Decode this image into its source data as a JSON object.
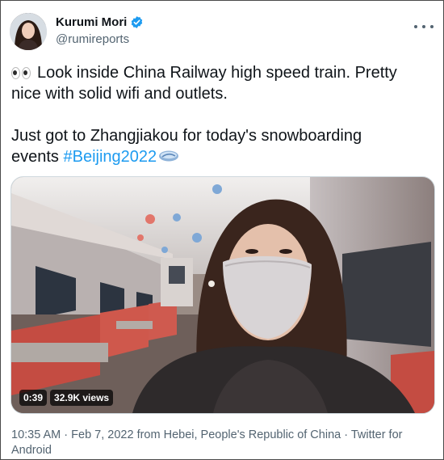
{
  "author": {
    "display_name": "Kurumi Mori",
    "handle": "@rumireports",
    "verified_icon": "verified-badge-icon",
    "avatar": "avatar"
  },
  "tweet": {
    "line1": "Look inside China Railway high speed train. Pretty",
    "line2": "nice with solid wifi and outlets.",
    "line3": "Just got to Zhangjiakou for today's snowboarding",
    "line4_prefix": "events ",
    "hashtag": "#Beijing2022",
    "emoji_icon": "eyes-icon"
  },
  "media": {
    "type": "video",
    "duration": "0:39",
    "views": "32.9K views"
  },
  "footer": {
    "timestamp": "10:35 AM · Feb 7, 2022 from Hebei, People's Republic of China · Twitter for Android"
  },
  "colors": {
    "accent": "#1d9bf0",
    "text": "#0f1419",
    "muted": "#536471"
  }
}
